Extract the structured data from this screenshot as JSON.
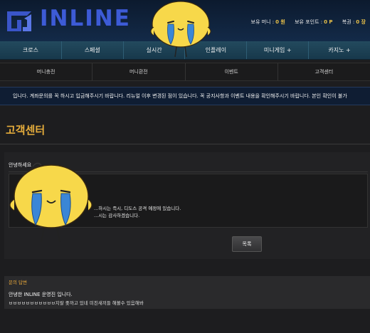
{
  "header": {
    "logo_text": "INLINE",
    "user_info": {
      "money_label": "보유 머니 :",
      "money_value": "0 원",
      "point_label": "보유 포인트 :",
      "point_value": "0 P",
      "ticket_label": "복권 :",
      "ticket_value": "0 장"
    }
  },
  "main_nav": [
    "크로스",
    "스페셜",
    "실시간",
    "인플레이",
    "미니게임 +",
    "카지노 +"
  ],
  "sub_nav": [
    "머니충전",
    "머니환전",
    "이벤트",
    "고객센터"
  ],
  "notice": {
    "text": "입니다. 계좌문의를 꼭 하시고 입금해주시기 바랍니다. 리뉴얼 이후 변경된 점이 있습니다. 꼭 공지사항과 이벤트 내용을 확인해주시기 바랍니다. 본인 확인이 불가"
  },
  "page": {
    "title": "고객센터",
    "greeting": "안녕하세요",
    "message_line1": "...하시는 즉시, 디도스 공격 예정에 있습니다.",
    "message_line2": "...시는 감사하겠습니다.",
    "list_button": "목록"
  },
  "reply": {
    "header": "문의 답변",
    "line1": "안녕한 INLINE 운영진 입니다.",
    "line2": "ㅂㅂㅂㅂㅂㅂㅂㅂㅂㅂㅂ지랄 좆까고 있네 미친새끼들 해볼수 있음해봐"
  },
  "colors": {
    "logo_blue": "#3d5bd6",
    "title_orange": "#e6ad3c",
    "nav_teal": "#1f4558",
    "chick_yellow": "#f7d84a",
    "tear_blue": "#3a86d6"
  },
  "stickers": [
    "crying-chick-icon",
    "crying-chick-icon"
  ]
}
